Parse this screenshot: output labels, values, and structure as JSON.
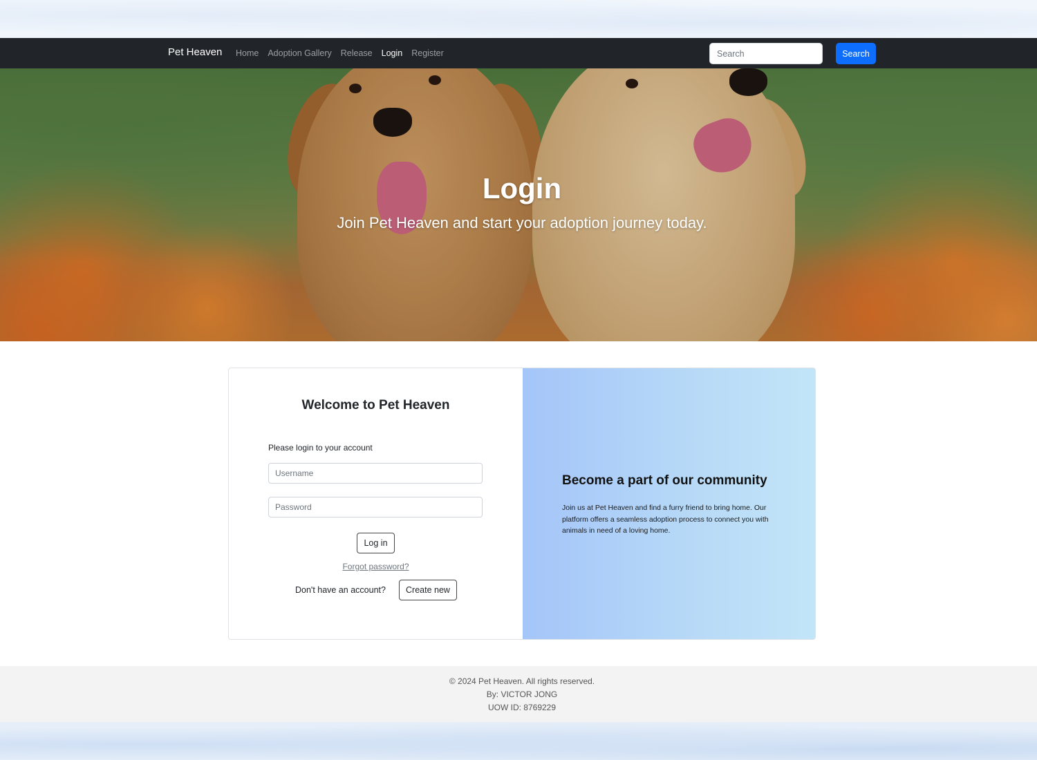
{
  "navbar": {
    "brand": "Pet Heaven",
    "links": [
      {
        "label": "Home",
        "active": false
      },
      {
        "label": "Adoption Gallery",
        "active": false
      },
      {
        "label": "Release",
        "active": false
      },
      {
        "label": "Login",
        "active": true
      },
      {
        "label": "Register",
        "active": false
      }
    ],
    "search_placeholder": "Search",
    "search_button": "Search"
  },
  "hero": {
    "title": "Login",
    "subtitle": "Join Pet Heaven and start your adoption journey today."
  },
  "login_card": {
    "welcome": "Welcome to Pet Heaven",
    "prompt": "Please login to your account",
    "username_placeholder": "Username",
    "password_placeholder": "Password",
    "login_button": "Log in",
    "forgot_password": "Forgot password?",
    "no_account": "Don't have an account?",
    "create_button": "Create new"
  },
  "community": {
    "title": "Become a part of our community",
    "text": "Join us at Pet Heaven and find a furry friend to bring home. Our platform offers a seamless adoption process to connect you with animals in need of a loving home."
  },
  "footer": {
    "copyright": "© 2024 Pet Heaven. All rights reserved.",
    "author": "By: VICTOR JONG",
    "uow_id": "UOW ID: 8769229"
  },
  "colors": {
    "navbar_bg": "#212529",
    "primary_button": "#0d6efd",
    "community_gradient_start": "#a4c5f8",
    "community_gradient_end": "#c2e5f8"
  }
}
